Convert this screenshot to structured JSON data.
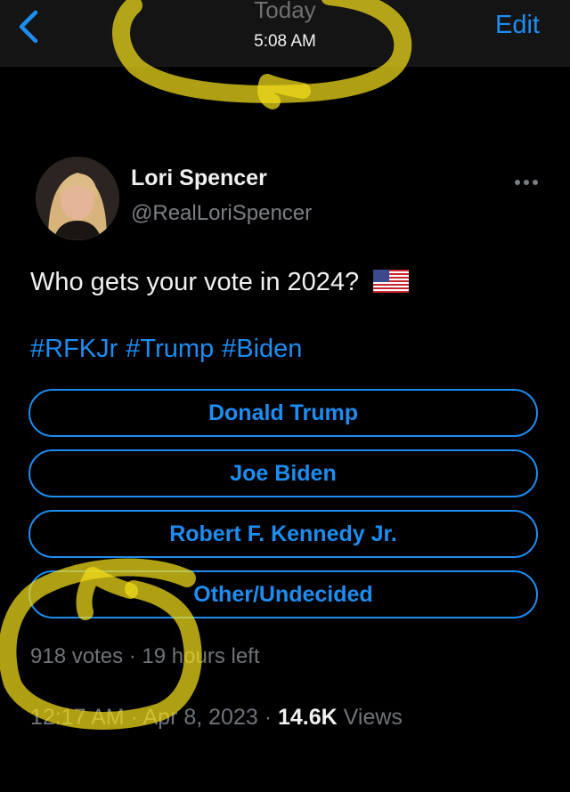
{
  "nav": {
    "back_icon": "chevron-left-icon",
    "title_day": "Today",
    "title_time": "5:08 AM",
    "edit_label": "Edit"
  },
  "tweet": {
    "author_name": "Lori Spencer",
    "author_handle": "@RealLoriSpencer",
    "more_icon": "ellipsis-icon",
    "text": "Who gets your vote in 2024?",
    "flag_icon": "us-flag-icon",
    "hashtags": [
      "#RFKJr",
      "#Trump",
      "#Biden"
    ]
  },
  "poll": {
    "options": [
      "Donald Trump",
      "Joe Biden",
      "Robert F. Kennedy Jr.",
      "Other/Undecided"
    ],
    "votes": "918 votes",
    "time_left": "19 hours left"
  },
  "meta": {
    "time": "12:17 AM",
    "date": "Apr 8, 2023",
    "views_count": "14.6K",
    "views_label": "Views"
  },
  "colors": {
    "accent": "#1d8df1",
    "background": "#000000",
    "header_background": "#141414",
    "muted_text": "#6f7479",
    "highlighter": "#f2dd1a"
  }
}
